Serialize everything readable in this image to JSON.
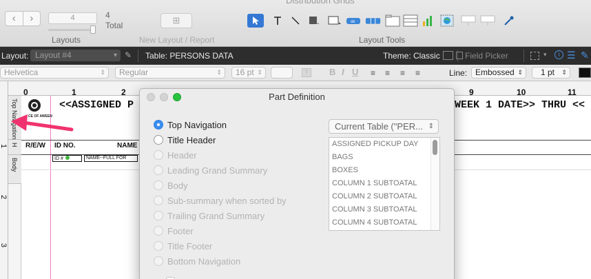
{
  "window": {
    "title": "Distribution Grids"
  },
  "toolbar": {
    "layout_number": "4",
    "layout_total": "4",
    "total_label": "Total",
    "layouts_label": "Layouts",
    "new_layout_label": "New Layout / Report",
    "layout_tools_label": "Layout Tools"
  },
  "layout_bar": {
    "layout_label": "Layout:",
    "layout_value": "Layout #4",
    "table_label": "Table: PERSONS DATA",
    "theme_label": "Theme: Classic",
    "field_picker_label": "Field Picker"
  },
  "format_bar": {
    "font": "Helvetica",
    "style": "Regular",
    "size": "16 pt",
    "line_label": "Line:",
    "line_style": "Embossed",
    "line_width": "1 pt"
  },
  "canvas": {
    "ruler_numbers": [
      "0",
      "1",
      "2",
      "9",
      "10",
      "11"
    ],
    "ruler_vertical": [
      "1",
      "2",
      "3"
    ],
    "parts": [
      "Top Navigation",
      "H",
      "Body"
    ],
    "header_left": "<<ASSIGNED P",
    "header_right": "WEEK 1 DATE>> THRU <<",
    "columns": [
      "R/E/W",
      "ID NO.",
      "NAME"
    ],
    "fields": [
      "ID #",
      "NAME--FULL FOR"
    ],
    "logo_text": "CE OF AWEEN"
  },
  "dialog": {
    "title": "Part Definition",
    "part_types": [
      {
        "label": "Top Navigation",
        "checked": true,
        "enabled": true
      },
      {
        "label": "Title Header",
        "checked": false,
        "enabled": true
      },
      {
        "label": "Header",
        "checked": false,
        "enabled": false
      },
      {
        "label": "Leading Grand Summary",
        "checked": false,
        "enabled": false
      },
      {
        "label": "Body",
        "checked": false,
        "enabled": false
      },
      {
        "label": "Sub-summary when sorted by",
        "checked": false,
        "enabled": false
      },
      {
        "label": "Trailing Grand Summary",
        "checked": false,
        "enabled": false
      },
      {
        "label": "Footer",
        "checked": false,
        "enabled": false
      },
      {
        "label": "Title Footer",
        "checked": false,
        "enabled": false
      },
      {
        "label": "Bottom Navigation",
        "checked": false,
        "enabled": false
      }
    ],
    "table_select": "Current Table (\"PER...",
    "fields": [
      "ASSIGNED PICKUP DAY",
      "BAGS",
      "BOXES",
      "COLUMN 1 SUBTOATAL",
      "COLUMN 2 SUBTOATAL",
      "COLUMN 3 SUBTOATAL",
      "COLUMN 4 SUBTOATAL"
    ]
  },
  "colors": {
    "accent": "#3478d4",
    "selected_radio": "#3a8ef0",
    "annotation_arrow": "#f0336e",
    "page_guide": "#f27bc3"
  }
}
